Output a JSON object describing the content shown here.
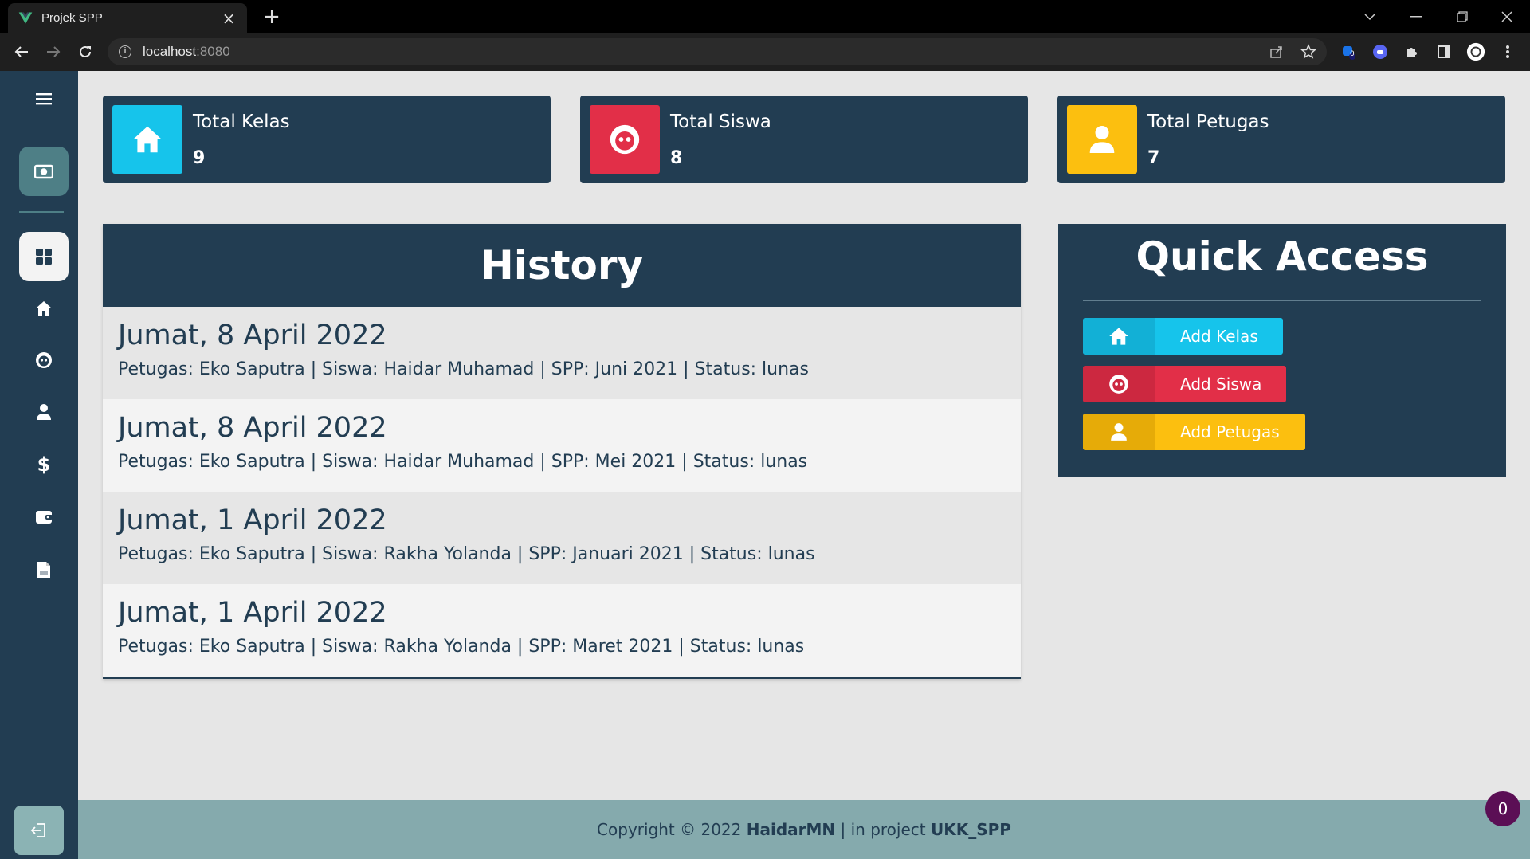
{
  "browser": {
    "tab_title": "Projek SPP",
    "url_host": "localhost",
    "url_port": ":8080",
    "extension_badge": "0"
  },
  "sidebar": {
    "items": [
      {
        "icon": "camera-icon",
        "active": false
      },
      {
        "icon": "dashboard-icon",
        "active": true
      },
      {
        "icon": "home-icon"
      },
      {
        "icon": "face-icon"
      },
      {
        "icon": "user-icon"
      },
      {
        "icon": "dollar-icon"
      },
      {
        "icon": "wallet-icon"
      },
      {
        "icon": "pdf-icon"
      }
    ]
  },
  "stats": [
    {
      "label": "Total Kelas",
      "value": "9",
      "color": "#16c4eb",
      "icon": "home-icon"
    },
    {
      "label": "Total Siswa",
      "value": "8",
      "color": "#e22f48",
      "icon": "face-icon"
    },
    {
      "label": "Total Petugas",
      "value": "7",
      "color": "#fcbf0f",
      "icon": "user-icon"
    }
  ],
  "history": {
    "title": "History",
    "items": [
      {
        "date": "Jumat, 8 April 2022",
        "detail": "Petugas: Eko Saputra | Siswa: Haidar Muhamad | SPP: Juni 2021 | Status: lunas"
      },
      {
        "date": "Jumat, 8 April 2022",
        "detail": "Petugas: Eko Saputra | Siswa: Haidar Muhamad | SPP: Mei 2021 | Status: lunas"
      },
      {
        "date": "Jumat, 1 April 2022",
        "detail": "Petugas: Eko Saputra | Siswa: Rakha Yolanda | SPP: Januari 2021 | Status: lunas"
      },
      {
        "date": "Jumat, 1 April 2022",
        "detail": "Petugas: Eko Saputra | Siswa: Rakha Yolanda | SPP: Maret 2021 | Status: lunas"
      }
    ]
  },
  "quick_access": {
    "title": "Quick Access",
    "buttons": [
      {
        "label": "Add Kelas",
        "color": "#16c4eb",
        "icon_bg": "#12b0d6"
      },
      {
        "label": "Add Siswa",
        "color": "#e22f48",
        "icon_bg": "#cc2840"
      },
      {
        "label": "Add Petugas",
        "color": "#fcbf0f",
        "icon_bg": "#e6ab08"
      }
    ]
  },
  "footer": {
    "prefix": "Copyright © 2022 ",
    "author": "HaidarMN",
    "middle": " | in project ",
    "project": "UKK_SPP"
  },
  "notification_badge": "0",
  "colors": {
    "sidebar": "#223d52",
    "active_item": "#4e7f86",
    "footer": "#85aaad"
  }
}
